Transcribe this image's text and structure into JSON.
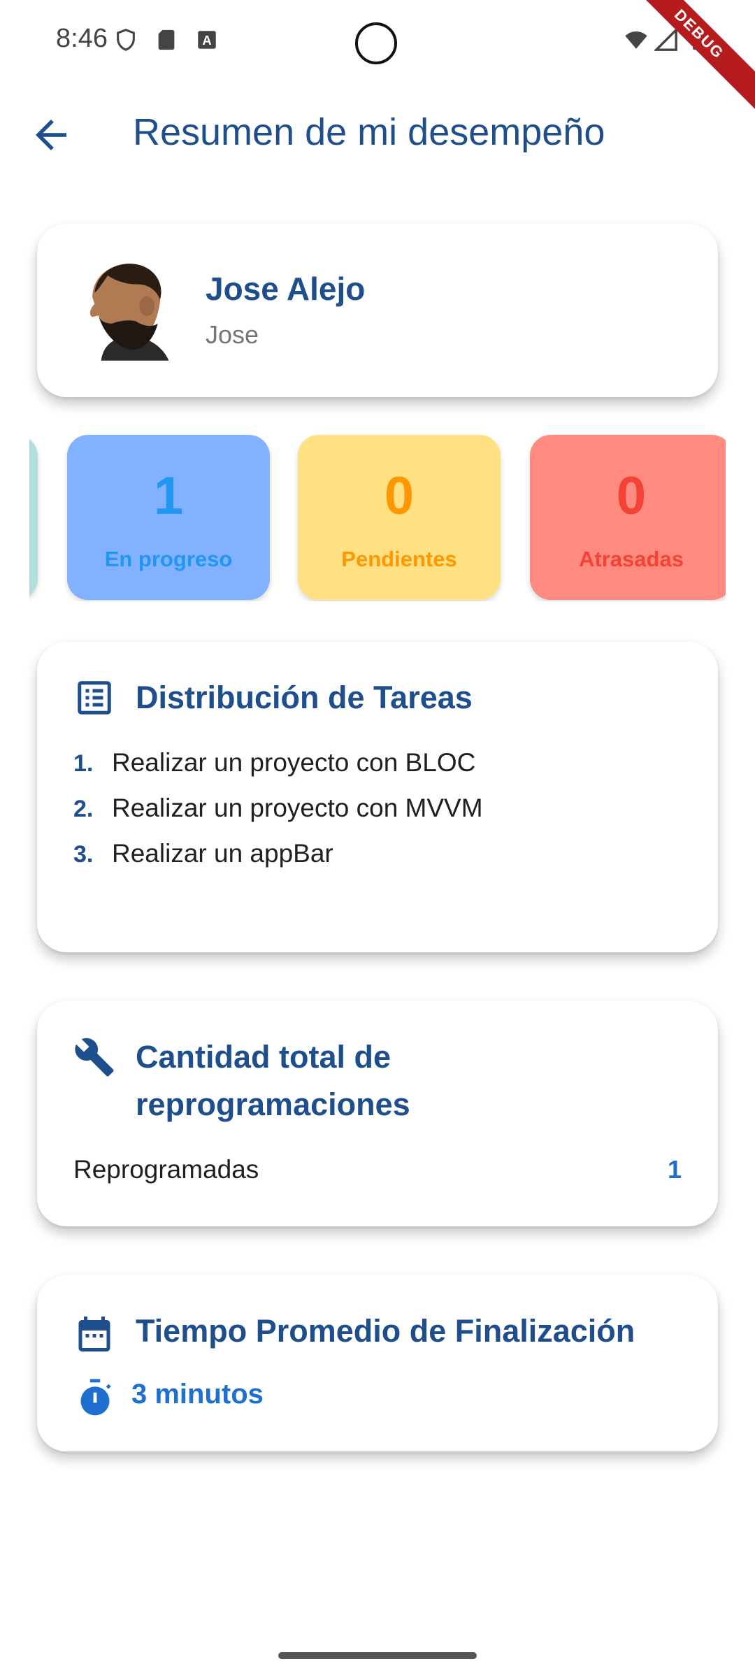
{
  "status_bar": {
    "time": "8:46",
    "debug_label": "DEBUG",
    "icons": [
      "shield-icon",
      "sd-card-icon",
      "keyboard-a-icon",
      "wifi-icon",
      "signal-icon",
      "battery-icon"
    ]
  },
  "app_bar": {
    "title": "Resumen de mi desempeño",
    "back_icon": "arrow-back-icon"
  },
  "profile": {
    "name": "Jose Alejo",
    "username": "Jose"
  },
  "stats": [
    {
      "value": "1",
      "label": "En progreso",
      "bg": "#82b1ff",
      "color": "#2196f3"
    },
    {
      "value": "0",
      "label": "Pendientes",
      "bg": "#ffe082",
      "color": "#ff9800"
    },
    {
      "value": "0",
      "label": "Atrasadas",
      "bg": "#ff8a80",
      "color": "#f44336"
    }
  ],
  "tasks": {
    "title": "Distribución de Tareas",
    "icon": "list-alt-icon",
    "items": [
      {
        "num": "1.",
        "text": "Realizar un proyecto con BLOC"
      },
      {
        "num": "2.",
        "text": "Realizar un proyecto con MVVM"
      },
      {
        "num": "3.",
        "text": "Realizar un appBar"
      }
    ]
  },
  "reschedules": {
    "title_line1": "Cantidad total de",
    "title_line2": "reprogramaciones",
    "icon": "wrench-icon",
    "label": "Reprogramadas",
    "value": "1"
  },
  "avg_time": {
    "title": "Tiempo Promedio de Finalización",
    "icon": "calendar-icon",
    "value_icon": "timer-icon",
    "value": "3 minutos"
  },
  "colors": {
    "primary": "#1e4e8c",
    "accent": "#1e6fd0"
  }
}
